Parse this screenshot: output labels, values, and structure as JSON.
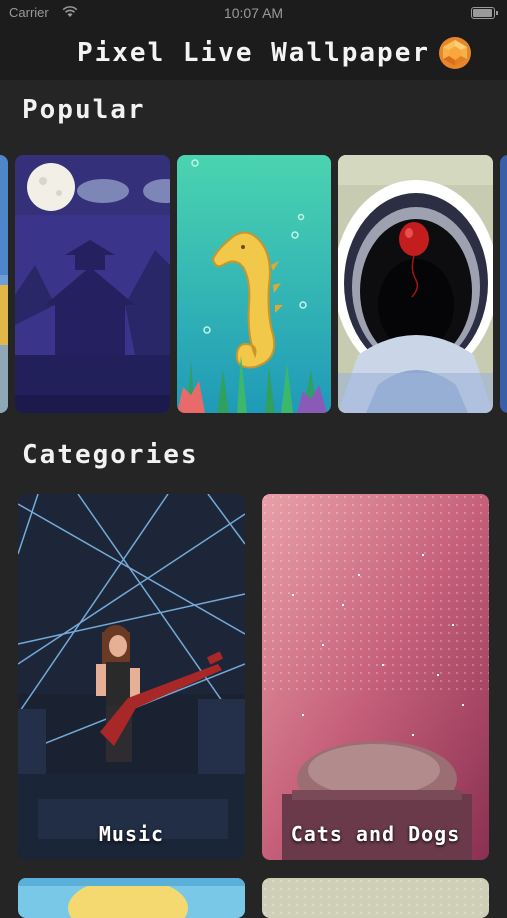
{
  "status": {
    "carrier": "Carrier",
    "time": "10:07 AM"
  },
  "nav": {
    "title": "Pixel Live Wallpaper"
  },
  "popular": {
    "title": "Popular",
    "items": [
      {
        "name": "blue-edge-wallpaper"
      },
      {
        "name": "moonlit-pagoda-wallpaper"
      },
      {
        "name": "seahorse-wallpaper"
      },
      {
        "name": "red-balloon-drain-wallpaper"
      }
    ]
  },
  "categories": {
    "title": "Categories",
    "items": [
      {
        "label": "Music"
      },
      {
        "label": "Cats and Dogs"
      }
    ]
  },
  "colors": {
    "background": "#252525",
    "bar": "#1c1c1c",
    "text": "#ffffff",
    "gem": "#f4a83a"
  }
}
